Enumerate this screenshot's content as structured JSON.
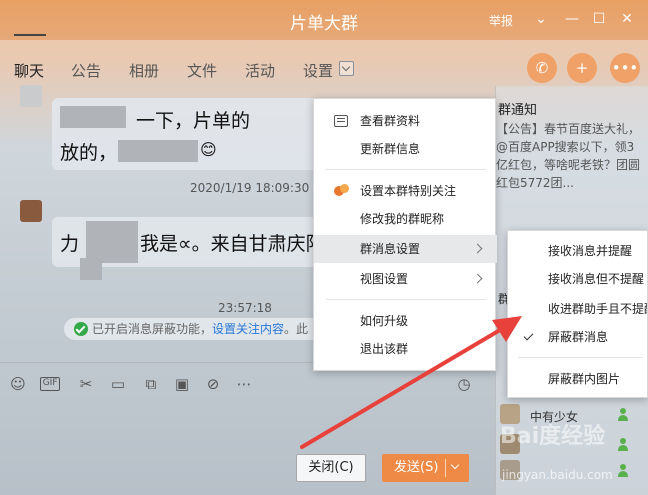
{
  "window": {
    "title": "片单大群",
    "report_label": "举报",
    "minimize": "—",
    "maximize": "☐",
    "close": "✕"
  },
  "tabs": [
    "聊天",
    "公告",
    "相册",
    "文件",
    "活动",
    "设置"
  ],
  "chat": {
    "msg1_line1": "一下，片单的",
    "msg1_prefix": "放的，",
    "time1": "2020/1/19 18:09:30",
    "msg2_a": "力",
    "msg2_b": "我是∝。来自甘肃庆阳",
    "time2": "23:57:18",
    "notice_text": "已开启消息屏蔽功能，",
    "notice_link": "设置关注内容",
    "notice_suffix": "。此"
  },
  "buttons": {
    "close": "关闭(C)",
    "send": "发送(S)"
  },
  "group_notice": {
    "title": "群通知",
    "prefix": "【公告】",
    "body": "春节百度送大礼，@百度APP搜索以下，领3亿红包，等啥呢老铁？团圆红包5772团...",
    "link_text": "@百度APP",
    "member_label": "群"
  },
  "members": [
    "中有少女",
    "",
    ""
  ],
  "context_menu": [
    {
      "label": "查看群资料",
      "icon": "doc-icon"
    },
    {
      "label": "更新群信息"
    },
    {
      "label": "设置本群特别关注",
      "icon": "favorite-icon"
    },
    {
      "label": "修改我的群昵称"
    },
    {
      "label": "群消息设置",
      "submenu": true
    },
    {
      "label": "视图设置",
      "submenu": true
    },
    {
      "label": "如何升级"
    },
    {
      "label": "退出该群"
    }
  ],
  "submenu": [
    {
      "label": "接收消息并提醒"
    },
    {
      "label": "接收消息但不提醒"
    },
    {
      "label": "收进群助手且不提醒"
    },
    {
      "label": "屏蔽群消息",
      "checked": true
    },
    {
      "label": "屏蔽群内图片"
    }
  ],
  "watermark": {
    "brand": "Bai度经验",
    "url": "jingyan.baidu.com"
  },
  "colors": {
    "accent": "#ee8a45",
    "title_bar": "#e9a064",
    "link": "#2a77d6",
    "arrow": "#e8403a"
  }
}
